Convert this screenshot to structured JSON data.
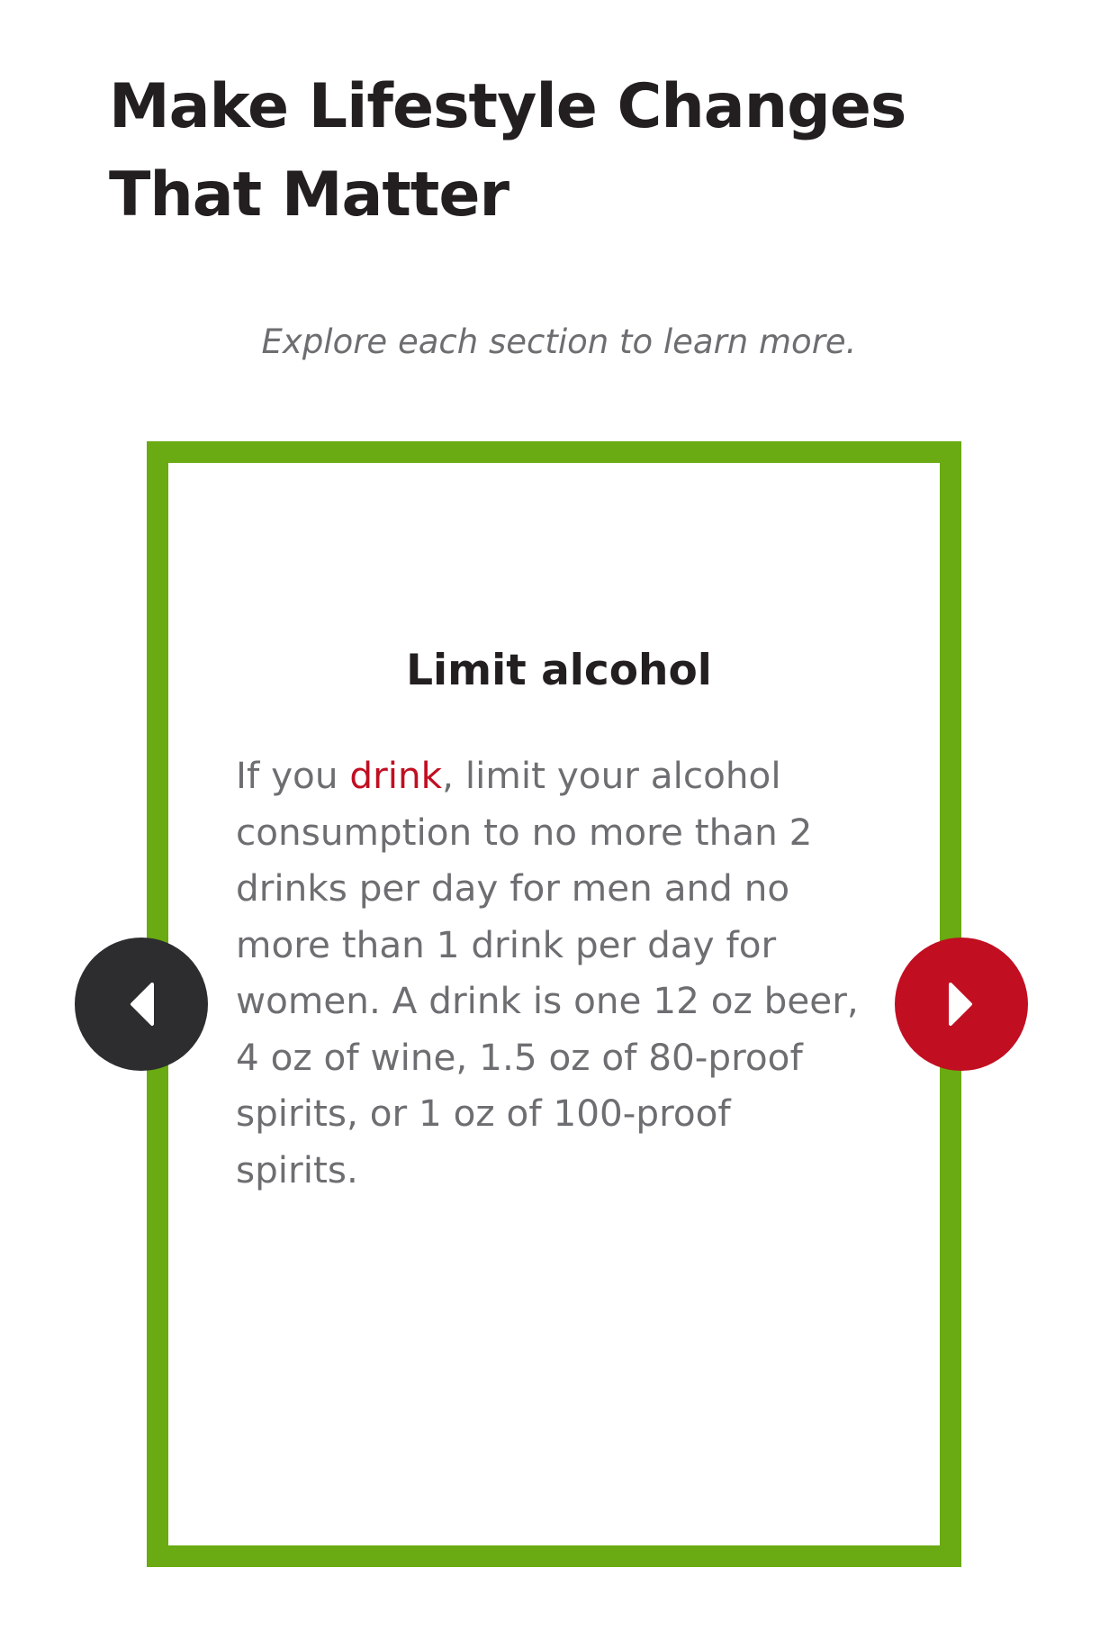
{
  "header": {
    "title_line1": "Make Lifestyle Changes",
    "title_line2": "That Matter"
  },
  "intro": "Explore each section to learn more.",
  "card": {
    "heading": "Limit alcohol",
    "body": {
      "line1_pre": "If you ",
      "line1_link": "drink",
      "line1_post": ", limit your alcohol",
      "line2": "consumption to no more than 2",
      "line3": "drinks per day for men and no",
      "line4": "more than 1 drink per day for",
      "line5": "women. A drink is one 12 oz beer,",
      "line6": "4 oz of wine, 1.5 oz of 80-proof",
      "line7": "spirits, or 1 oz of 100-proof",
      "line8": "spirits."
    }
  },
  "carousel": {
    "prev_icon": "chevron-left-icon",
    "next_icon": "chevron-right-icon",
    "card_border_color": "#6aaa12",
    "prev_color": "#2d2d2f",
    "next_color": "#c10e21",
    "link_color": "#c10e21"
  }
}
